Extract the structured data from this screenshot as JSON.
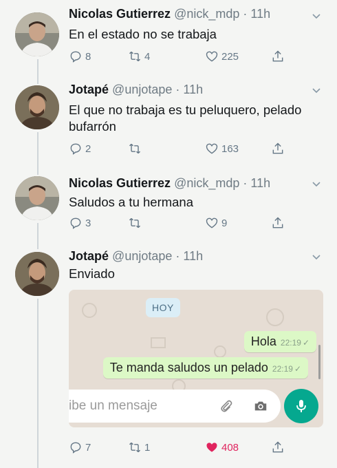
{
  "tweets": [
    {
      "name": "Nicolas Gutierrez",
      "handle": "@nick_mdp",
      "time": "· 11h",
      "text": "En el estado no se trabaja",
      "replies": "8",
      "retweets": "4",
      "likes": "225"
    },
    {
      "name": "Jotapé",
      "handle": "@unjotape",
      "time": "· 11h",
      "text": "El que no trabaja es tu peluquero, pelado bufarrón",
      "replies": "2",
      "retweets": "",
      "likes": "163"
    },
    {
      "name": "Nicolas Gutierrez",
      "handle": "@nick_mdp",
      "time": "· 11h",
      "text": "Saludos a tu hermana",
      "replies": "3",
      "retweets": "",
      "likes": "9"
    },
    {
      "name": "Jotapé",
      "handle": "@unjotape",
      "time": "· 11h",
      "text": "Enviado",
      "replies": "7",
      "retweets": "1",
      "likes": "408"
    }
  ],
  "whatsapp": {
    "date_chip": "HOY",
    "messages": [
      {
        "text": "Hola",
        "time": "22:19",
        "tick": "✓"
      },
      {
        "text": "Te manda saludos un pelado",
        "time": "22:19",
        "tick": "✓"
      }
    ],
    "input_placeholder": "ibe un mensaje"
  },
  "colors": {
    "like_active": "#e0245e",
    "action_gray": "#657786",
    "wa_bubble_out": "#dcf8c6",
    "wa_mic": "#05a88f"
  }
}
